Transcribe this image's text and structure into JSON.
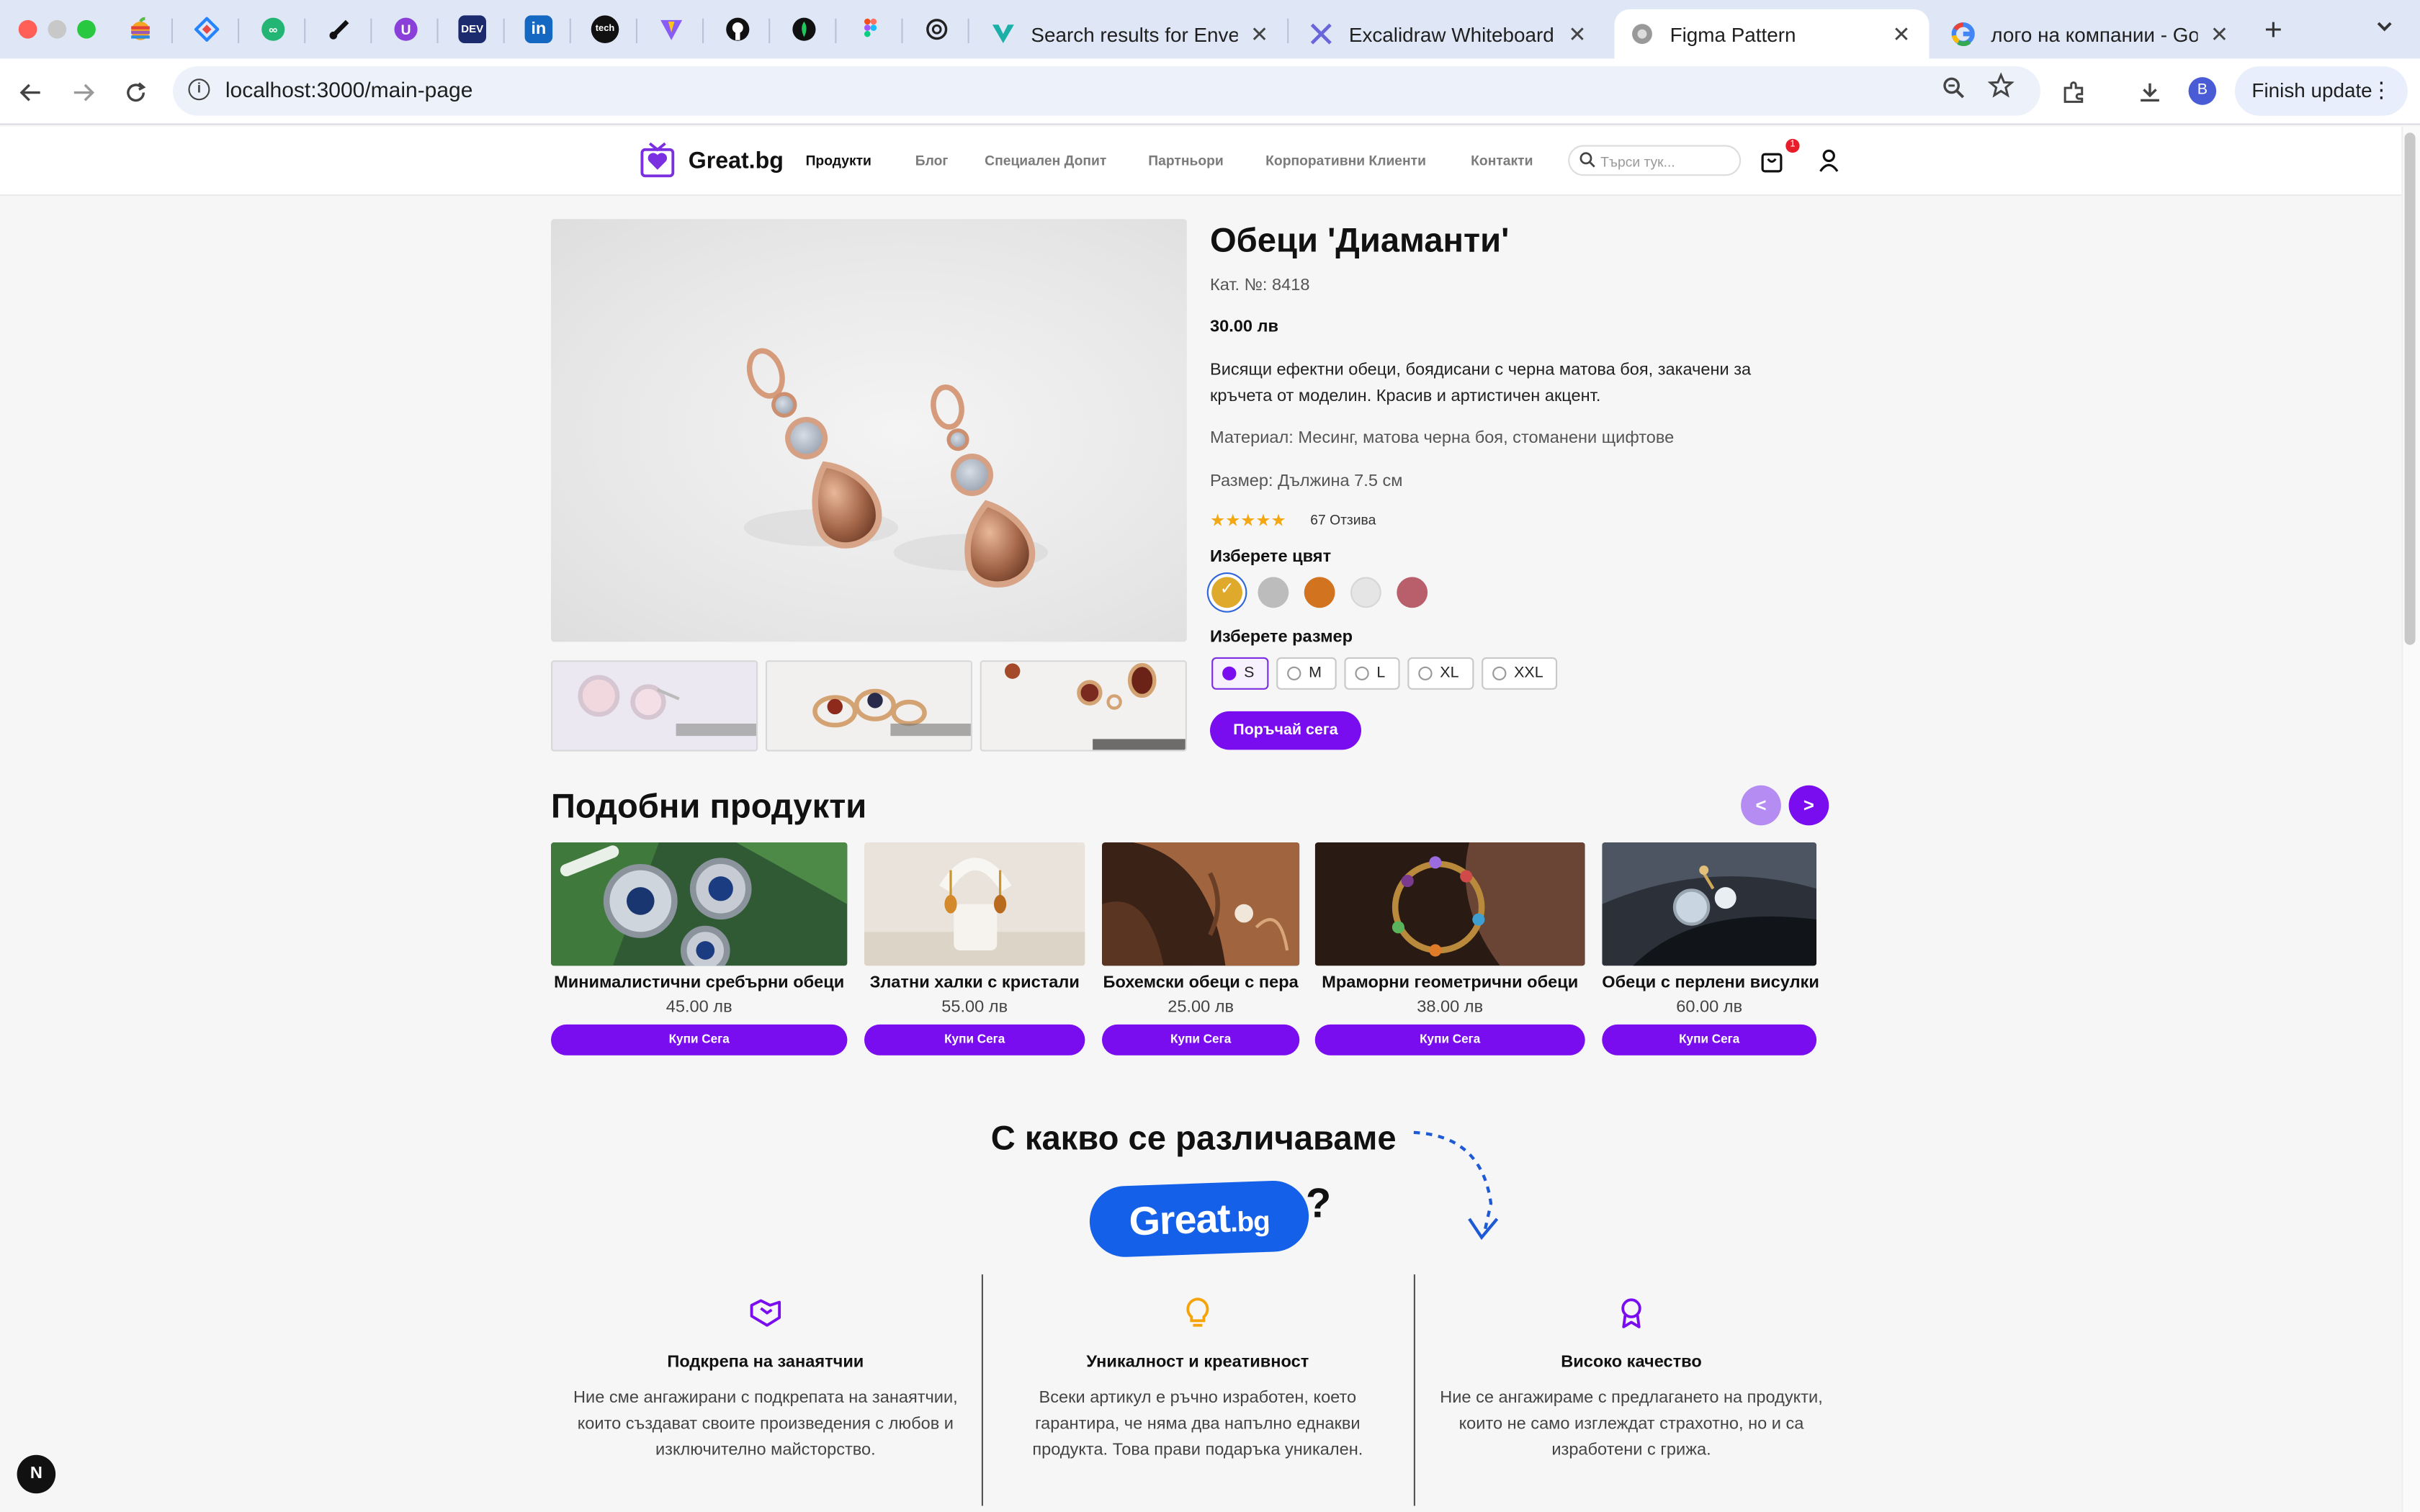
{
  "browser": {
    "tabs": [
      {
        "title": "Search results for Envelope",
        "favicon": "V",
        "color": "#20b2aa"
      },
      {
        "title": "Excalidraw Whiteboard",
        "favicon": "✎",
        "color": "#6965db"
      },
      {
        "title": "Figma Pattern",
        "favicon": "◍",
        "color": "#777777",
        "active": true
      },
      {
        "title": "лого на компании - Google",
        "favicon": "G",
        "color": "#4285f4"
      }
    ],
    "pinned_tabs": [
      "apple-icon",
      "jira-icon",
      "mooc-icon",
      "dataflow-icon",
      "upwork-icon",
      "dev-icon",
      "linkedin-icon",
      "tech-icon",
      "vite-icon",
      "github-icon",
      "mongodb-icon",
      "figma-icon",
      "chatgpt-icon"
    ],
    "dev_label": "DEV",
    "linkedin_label": "in",
    "tech_label": "tech",
    "url": "localhost:3000/main-page",
    "profile_initial": "B",
    "finish_update": "Finish update",
    "close_glyph": "✕",
    "new_tab_glyph": "+"
  },
  "site": {
    "brand": "Great.bg",
    "nav": [
      "Продукти",
      "Блог",
      "Специален Допит",
      "Партньори",
      "Корпоративни Клиенти",
      "Контакти"
    ],
    "search_placeholder": "Търси тук...",
    "cart_count": "1",
    "next_badge": "N"
  },
  "product": {
    "title": "Обеци 'Диаманти'",
    "catalog": "Кат. №: 8418",
    "price": "30.00 лв",
    "description": "Висящи ефектни обеци, боядисани с черна матова боя, закачени за кръчета от моделин. Красив и артистичен акцент.",
    "material": "Материал: Месинг, матова черна боя, стоманени щифтове",
    "size": "Размер: Дължина 7.5 см",
    "rating": 5,
    "stars": "★★★★★",
    "reviews": "67 Отзива",
    "choose_color": "Изберете цвят",
    "colors": [
      "#dfa92c",
      "#bcbcbc",
      "#d2731f",
      "#e5e5e5",
      "#b85f6b"
    ],
    "selected_color_index": 0,
    "choose_size": "Изберете размер",
    "sizes": [
      "S",
      "M",
      "L",
      "XL",
      "XXL"
    ],
    "selected_size": "S",
    "order_button": "Поръчай сега"
  },
  "similar": {
    "title": "Подобни продукти",
    "prev": "<",
    "next": ">",
    "items": [
      {
        "name": "Минималистични сребърни обеци",
        "price": "45.00 лв",
        "buy": "Купи Сега"
      },
      {
        "name": "Златни халки с кристали",
        "price": "55.00 лв",
        "buy": "Купи Сега"
      },
      {
        "name": "Бохемски обеци с пера",
        "price": "25.00 лв",
        "buy": "Купи Сега"
      },
      {
        "name": "Мраморни геометрични обеци",
        "price": "38.00 лв",
        "buy": "Купи Сега"
      },
      {
        "name": "Обеци с перлени висулки",
        "price": "60.00 лв",
        "buy": "Купи Сега"
      }
    ]
  },
  "difference": {
    "title": "С какво се различаваме",
    "badge_main": "Great",
    "badge_suffix": ".bg",
    "question": "?",
    "features": [
      {
        "title": "Подкрепа на занаятчии",
        "text": "Ние сме ангажирани с подкрепата на занаятчии, които създават своите произведения с любов и изключително майсторство.",
        "icon": "handshake-icon"
      },
      {
        "title": "Уникалност и креативност",
        "text": "Всеки артикул е ръчно изработен, което гарантира, че няма два напълно еднакви продукта. Това прави подаръка уникален.",
        "icon": "lightbulb-icon"
      },
      {
        "title": "Високо качество",
        "text": "Ние се ангажираме с предлагането на продукти, които не само изглеждат страхотно, но и са изработени с грижа.",
        "icon": "award-icon"
      }
    ]
  }
}
